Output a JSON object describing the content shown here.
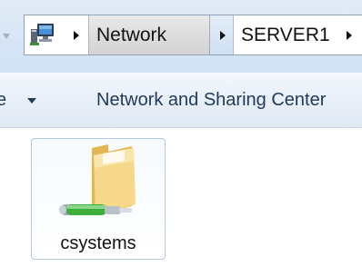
{
  "address_bar": {
    "computer_icon": "computer-icon",
    "breadcrumbs": [
      {
        "label": "Network"
      },
      {
        "label": "SERVER1"
      }
    ]
  },
  "toolbar": {
    "organize_fragment": "e",
    "network_sharing_link": "Network and Sharing Center"
  },
  "content": {
    "items": [
      {
        "label": "csystems",
        "icon": "network-share-folder-icon"
      }
    ]
  },
  "colors": {
    "toolbar_text": "#1e395b",
    "address_border": "#8fa2b8",
    "tile_border": "#b4c9e0",
    "folder_yellow": "#f2d27a",
    "pipe_green": "#3cae3a"
  }
}
